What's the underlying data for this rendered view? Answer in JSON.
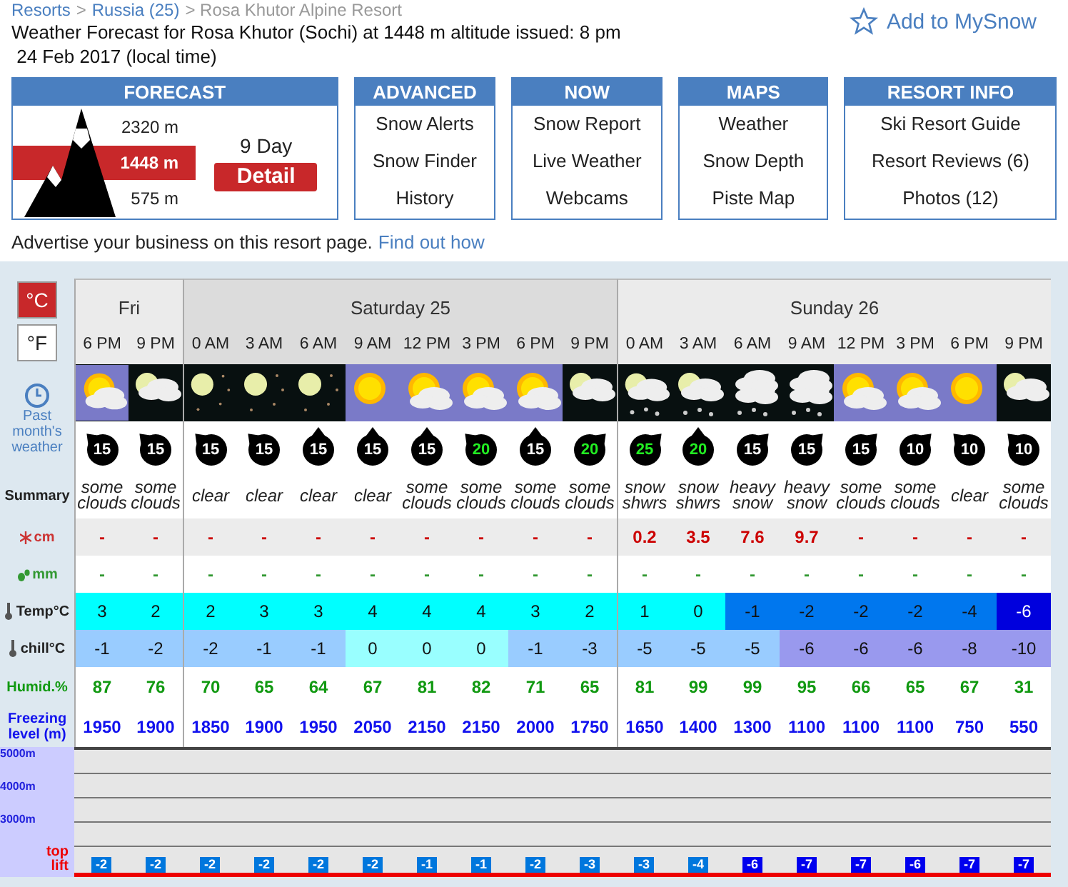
{
  "breadcrumb": [
    {
      "label": "Resorts",
      "link": true
    },
    {
      "label": ">",
      "link": false
    },
    {
      "label": "Russia (25)",
      "link": true
    },
    {
      "label": "> Rosa Khutor Alpine Resort",
      "link": false
    }
  ],
  "title": "Weather Forecast for Rosa Khutor (Sochi) at 1448 m altitude issued: 8 pm",
  "subtitle": " 24 Feb 2017 (local time)",
  "add_button": "Add to MySnow",
  "forecast_box": {
    "heading": "FORECAST",
    "top": "2320 m",
    "current": "1448 m",
    "bottom": "575 m",
    "days": "9 Day",
    "detail": "Detail"
  },
  "menus": [
    {
      "heading": "ADVANCED",
      "items": [
        "Snow Alerts",
        "Snow Finder",
        "History"
      ]
    },
    {
      "heading": "NOW",
      "items": [
        "Snow Report",
        "Live Weather",
        "Webcams"
      ]
    },
    {
      "heading": "MAPS",
      "items": [
        "Weather",
        "Snow Depth",
        "Piste Map"
      ]
    },
    {
      "heading": "RESORT INFO",
      "items": [
        "Ski Resort Guide",
        "Resort Reviews (6)",
        "Photos (12)"
      ]
    }
  ],
  "advertise": {
    "text": "Advertise your business on this resort page.",
    "link": "Find out how"
  },
  "units": [
    {
      "label": "°C",
      "selected": true
    },
    {
      "label": "°F",
      "selected": false
    }
  ],
  "past_weather": "Past month's weather",
  "row_labels": {
    "summary": "Summary",
    "snow": "cm",
    "rain": "mm",
    "temp": "Temp°C",
    "chill": "chill°C",
    "humidity": "Humid.%",
    "freezing": "Freezing level (m)"
  },
  "chart_labels": [
    "5000m",
    "4000m",
    "3000m"
  ],
  "top_lift_label": "top lift",
  "days": [
    {
      "label": "Fri",
      "slots": [
        {
          "time": "6 PM",
          "sky": {
            "kind": "sun-cloud"
          },
          "wind": {
            "speed": "15",
            "strong": false,
            "kind": "nw"
          },
          "summary": "some clouds",
          "snow": "-",
          "rain": "-",
          "temp": {
            "value": "3",
            "color": "#00ffff"
          },
          "chill": {
            "value": "-1",
            "color": "#99ccff"
          },
          "humidity": "87",
          "freezing": "1950",
          "top_lift": {
            "value": "-2",
            "color": "#0077dd"
          }
        },
        {
          "time": "9 PM",
          "sky": {
            "kind": "moon-cloud"
          },
          "wind": {
            "speed": "15",
            "strong": false,
            "kind": "nw"
          },
          "summary": "some clouds",
          "snow": "-",
          "rain": "-",
          "temp": {
            "value": "2",
            "color": "#00ffff"
          },
          "chill": {
            "value": "-2",
            "color": "#99ccff"
          },
          "humidity": "76",
          "freezing": "1900",
          "top_lift": {
            "value": "-2",
            "color": "#0077dd"
          }
        }
      ]
    },
    {
      "label": "Saturday 25",
      "slots": [
        {
          "time": "0 AM",
          "sky": {
            "kind": "moon-stars"
          },
          "wind": {
            "speed": "15",
            "strong": false,
            "kind": "nw"
          },
          "summary": "clear",
          "snow": "-",
          "rain": "-",
          "temp": {
            "value": "2",
            "color": "#00ffff"
          },
          "chill": {
            "value": "-2",
            "color": "#99ccff"
          },
          "humidity": "70",
          "freezing": "1850",
          "top_lift": {
            "value": "-2",
            "color": "#0077dd"
          }
        },
        {
          "time": "3 AM",
          "sky": {
            "kind": "moon-stars"
          },
          "wind": {
            "speed": "15",
            "strong": false,
            "kind": "nw"
          },
          "summary": "clear",
          "snow": "-",
          "rain": "-",
          "temp": {
            "value": "3",
            "color": "#00ffff"
          },
          "chill": {
            "value": "-1",
            "color": "#99ccff"
          },
          "humidity": "65",
          "freezing": "1900",
          "top_lift": {
            "value": "-2",
            "color": "#0077dd"
          }
        },
        {
          "time": "6 AM",
          "sky": {
            "kind": "moon-stars"
          },
          "wind": {
            "speed": "15",
            "strong": false,
            "kind": "n"
          },
          "summary": "clear",
          "snow": "-",
          "rain": "-",
          "temp": {
            "value": "3",
            "color": "#00ffff"
          },
          "chill": {
            "value": "-1",
            "color": "#99ccff"
          },
          "humidity": "64",
          "freezing": "1950",
          "top_lift": {
            "value": "-2",
            "color": "#0077dd"
          }
        },
        {
          "time": "9 AM",
          "sky": {
            "kind": "sun"
          },
          "wind": {
            "speed": "15",
            "strong": false,
            "kind": "n"
          },
          "summary": "clear",
          "snow": "-",
          "rain": "-",
          "temp": {
            "value": "4",
            "color": "#00ffff"
          },
          "chill": {
            "value": "0",
            "color": "#99ffff"
          },
          "humidity": "67",
          "freezing": "2050",
          "top_lift": {
            "value": "-2",
            "color": "#0077dd"
          }
        },
        {
          "time": "12 PM",
          "sky": {
            "kind": "sun-cloud"
          },
          "wind": {
            "speed": "15",
            "strong": false,
            "kind": "n"
          },
          "summary": "some clouds",
          "snow": "-",
          "rain": "-",
          "temp": {
            "value": "4",
            "color": "#00ffff"
          },
          "chill": {
            "value": "0",
            "color": "#99ffff"
          },
          "humidity": "81",
          "freezing": "2150",
          "top_lift": {
            "value": "-1",
            "color": "#0077dd"
          }
        },
        {
          "time": "3 PM",
          "sky": {
            "kind": "sun-cloud"
          },
          "wind": {
            "speed": "20",
            "strong": true,
            "kind": "nw"
          },
          "summary": "some clouds",
          "snow": "-",
          "rain": "-",
          "temp": {
            "value": "4",
            "color": "#00ffff"
          },
          "chill": {
            "value": "0",
            "color": "#99ffff"
          },
          "humidity": "82",
          "freezing": "2150",
          "top_lift": {
            "value": "-1",
            "color": "#0077dd"
          }
        },
        {
          "time": "6 PM",
          "sky": {
            "kind": "sun-cloud"
          },
          "wind": {
            "speed": "15",
            "strong": false,
            "kind": "n"
          },
          "summary": "some clouds",
          "snow": "-",
          "rain": "-",
          "temp": {
            "value": "3",
            "color": "#00ffff"
          },
          "chill": {
            "value": "-1",
            "color": "#99ccff"
          },
          "humidity": "71",
          "freezing": "2000",
          "top_lift": {
            "value": "-2",
            "color": "#0077dd"
          }
        },
        {
          "time": "9 PM",
          "sky": {
            "kind": "moon-cloud"
          },
          "wind": {
            "speed": "20",
            "strong": true,
            "kind": "ne"
          },
          "summary": "some clouds",
          "snow": "-",
          "rain": "-",
          "temp": {
            "value": "2",
            "color": "#00ffff"
          },
          "chill": {
            "value": "-3",
            "color": "#99ccff"
          },
          "humidity": "65",
          "freezing": "1750",
          "top_lift": {
            "value": "-3",
            "color": "#0077dd"
          }
        }
      ]
    },
    {
      "label": "Sunday 26",
      "slots": [
        {
          "time": "0 AM",
          "sky": {
            "kind": "moon-snow"
          },
          "wind": {
            "speed": "25",
            "strong": true,
            "kind": "ne"
          },
          "summary": "snow shwrs",
          "snow": "0.2",
          "rain": "-",
          "temp": {
            "value": "1",
            "color": "#00ffff"
          },
          "chill": {
            "value": "-5",
            "color": "#99ccff"
          },
          "humidity": "81",
          "freezing": "1650",
          "top_lift": {
            "value": "-3",
            "color": "#0077dd"
          }
        },
        {
          "time": "3 AM",
          "sky": {
            "kind": "moon-snow"
          },
          "wind": {
            "speed": "20",
            "strong": true,
            "kind": "n"
          },
          "summary": "snow shwrs",
          "snow": "3.5",
          "rain": "-",
          "temp": {
            "value": "0",
            "color": "#00ffff"
          },
          "chill": {
            "value": "-5",
            "color": "#99ccff"
          },
          "humidity": "99",
          "freezing": "1400",
          "top_lift": {
            "value": "-4",
            "color": "#0077dd"
          }
        },
        {
          "time": "6 AM",
          "sky": {
            "kind": "heavy-snow"
          },
          "wind": {
            "speed": "15",
            "strong": false,
            "kind": "ne"
          },
          "summary": "heavy snow",
          "snow": "7.6",
          "rain": "-",
          "temp": {
            "value": "-1",
            "color": "#0077ee"
          },
          "chill": {
            "value": "-5",
            "color": "#99ccff"
          },
          "humidity": "99",
          "freezing": "1300",
          "top_lift": {
            "value": "-6",
            "color": "#0000ee"
          }
        },
        {
          "time": "9 AM",
          "sky": {
            "kind": "heavy-snow"
          },
          "wind": {
            "speed": "15",
            "strong": false,
            "kind": "ne"
          },
          "summary": "heavy snow",
          "snow": "9.7",
          "rain": "-",
          "temp": {
            "value": "-2",
            "color": "#0077ee"
          },
          "chill": {
            "value": "-6",
            "color": "#9999ee"
          },
          "humidity": "95",
          "freezing": "1100",
          "top_lift": {
            "value": "-7",
            "color": "#0000ee"
          }
        },
        {
          "time": "12 PM",
          "sky": {
            "kind": "sun-cloud"
          },
          "wind": {
            "speed": "15",
            "strong": false,
            "kind": "ne"
          },
          "summary": "some clouds",
          "snow": "-",
          "rain": "-",
          "temp": {
            "value": "-2",
            "color": "#0077ee"
          },
          "chill": {
            "value": "-6",
            "color": "#9999ee"
          },
          "humidity": "66",
          "freezing": "1100",
          "top_lift": {
            "value": "-7",
            "color": "#0000ee"
          }
        },
        {
          "time": "3 PM",
          "sky": {
            "kind": "sun-cloud"
          },
          "wind": {
            "speed": "10",
            "strong": false,
            "kind": "ne"
          },
          "summary": "some clouds",
          "snow": "-",
          "rain": "-",
          "temp": {
            "value": "-2",
            "color": "#0077ee"
          },
          "chill": {
            "value": "-6",
            "color": "#9999ee"
          },
          "humidity": "65",
          "freezing": "1100",
          "top_lift": {
            "value": "-6",
            "color": "#0000ee"
          }
        },
        {
          "time": "6 PM",
          "sky": {
            "kind": "sun"
          },
          "wind": {
            "speed": "10",
            "strong": false,
            "kind": "nw"
          },
          "summary": "clear",
          "snow": "-",
          "rain": "-",
          "temp": {
            "value": "-4",
            "color": "#0077ee"
          },
          "chill": {
            "value": "-8",
            "color": "#9999ee"
          },
          "humidity": "67",
          "freezing": "750",
          "top_lift": {
            "value": "-7",
            "color": "#0000ee"
          }
        },
        {
          "time": "9 PM",
          "sky": {
            "kind": "moon-cloud"
          },
          "wind": {
            "speed": "10",
            "strong": false,
            "kind": "nw"
          },
          "summary": "some clouds",
          "snow": "-",
          "rain": "-",
          "temp": {
            "value": "-6",
            "color": "#0000dd"
          },
          "chill": {
            "value": "-10",
            "color": "#9999ee"
          },
          "humidity": "31",
          "freezing": "550",
          "top_lift": {
            "value": "-7",
            "color": "#0000ee"
          }
        }
      ]
    }
  ]
}
